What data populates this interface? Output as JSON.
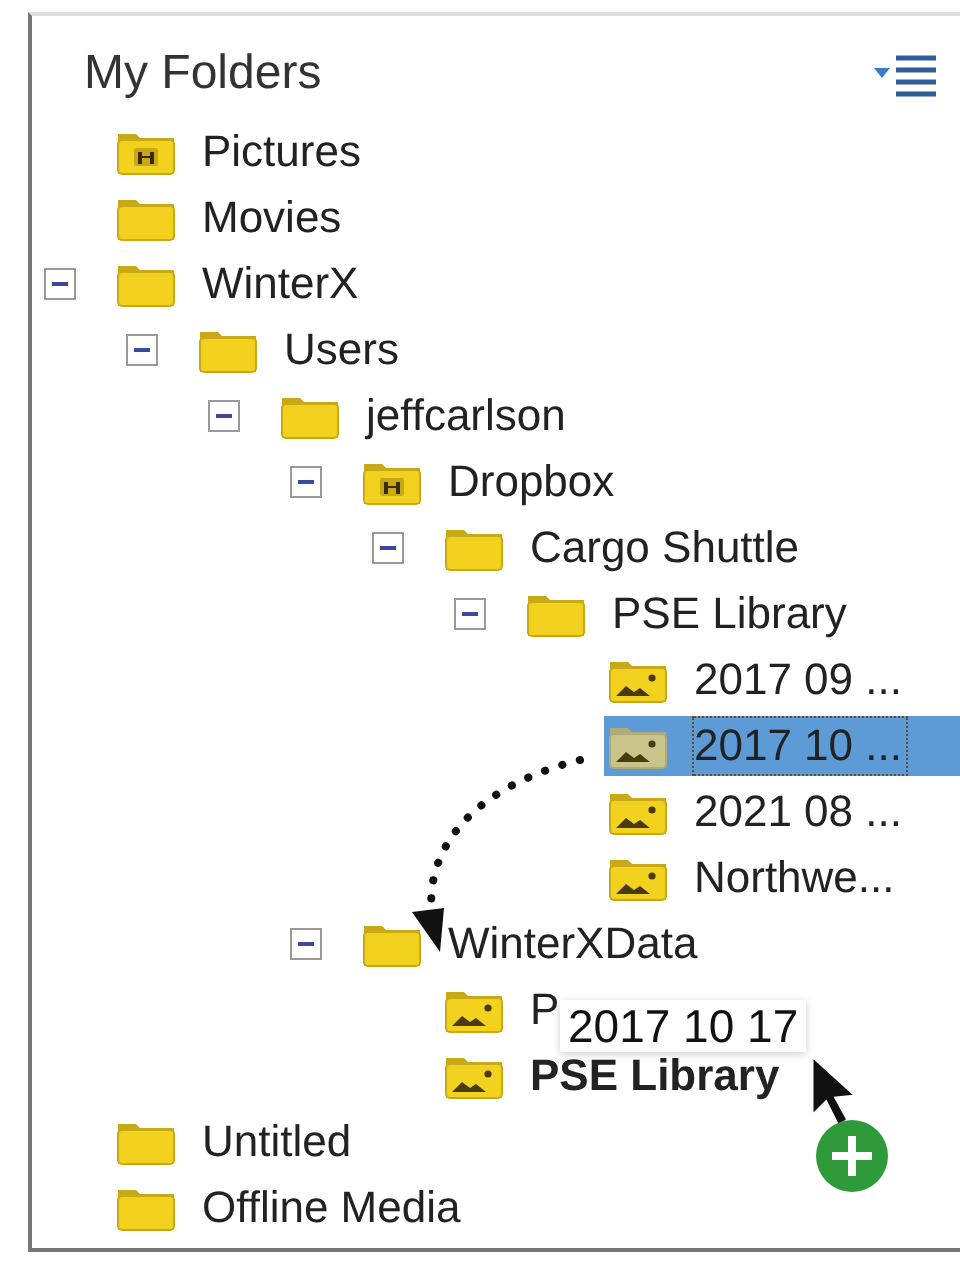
{
  "panel": {
    "title": "My Folders"
  },
  "tree": [
    {
      "label": "Pictures",
      "kind": "binocular-folder",
      "selected": false,
      "drop_target": false
    },
    {
      "label": "Movies",
      "kind": "folder",
      "selected": false,
      "drop_target": false
    },
    {
      "label": "WinterX",
      "kind": "folder",
      "selected": false,
      "drop_target": false,
      "expanded": true,
      "children": [
        {
          "label": "Users",
          "kind": "folder",
          "selected": false,
          "drop_target": false,
          "expanded": true,
          "children": [
            {
              "label": "jeffcarlson",
              "kind": "folder",
              "selected": false,
              "drop_target": false,
              "expanded": true,
              "children": [
                {
                  "label": "Dropbox",
                  "kind": "binocular-folder",
                  "selected": false,
                  "drop_target": false,
                  "expanded": true,
                  "children": [
                    {
                      "label": "Cargo Shuttle",
                      "kind": "folder",
                      "selected": false,
                      "drop_target": false,
                      "expanded": true,
                      "children": [
                        {
                          "label": "PSE Library",
                          "kind": "folder",
                          "selected": false,
                          "drop_target": false,
                          "expanded": true,
                          "children": [
                            {
                              "label": "2017 09 ...",
                              "kind": "photo-folder",
                              "selected": false,
                              "drop_target": false
                            },
                            {
                              "label": "2017 10 ...",
                              "kind": "photo-folder",
                              "selected": true,
                              "drop_target": false
                            },
                            {
                              "label": "2021 08 ...",
                              "kind": "photo-folder",
                              "selected": false,
                              "drop_target": false
                            },
                            {
                              "label": "Northwe...",
                              "kind": "photo-folder",
                              "selected": false,
                              "drop_target": false
                            }
                          ]
                        }
                      ]
                    }
                  ]
                },
                {
                  "label": "WinterXData",
                  "kind": "folder",
                  "selected": false,
                  "drop_target": false,
                  "expanded": true,
                  "children": [
                    {
                      "label": "P",
                      "kind": "photo-folder",
                      "selected": false,
                      "drop_target": false
                    },
                    {
                      "label": "PSE Library",
                      "kind": "photo-folder",
                      "selected": false,
                      "drop_target": true
                    }
                  ]
                }
              ]
            }
          ]
        }
      ]
    },
    {
      "label": "Untitled",
      "kind": "folder",
      "selected": false,
      "drop_target": false
    },
    {
      "label": "Offline Media",
      "kind": "folder",
      "selected": false,
      "drop_target": false
    }
  ],
  "drag": {
    "label": "2017 10 17"
  }
}
